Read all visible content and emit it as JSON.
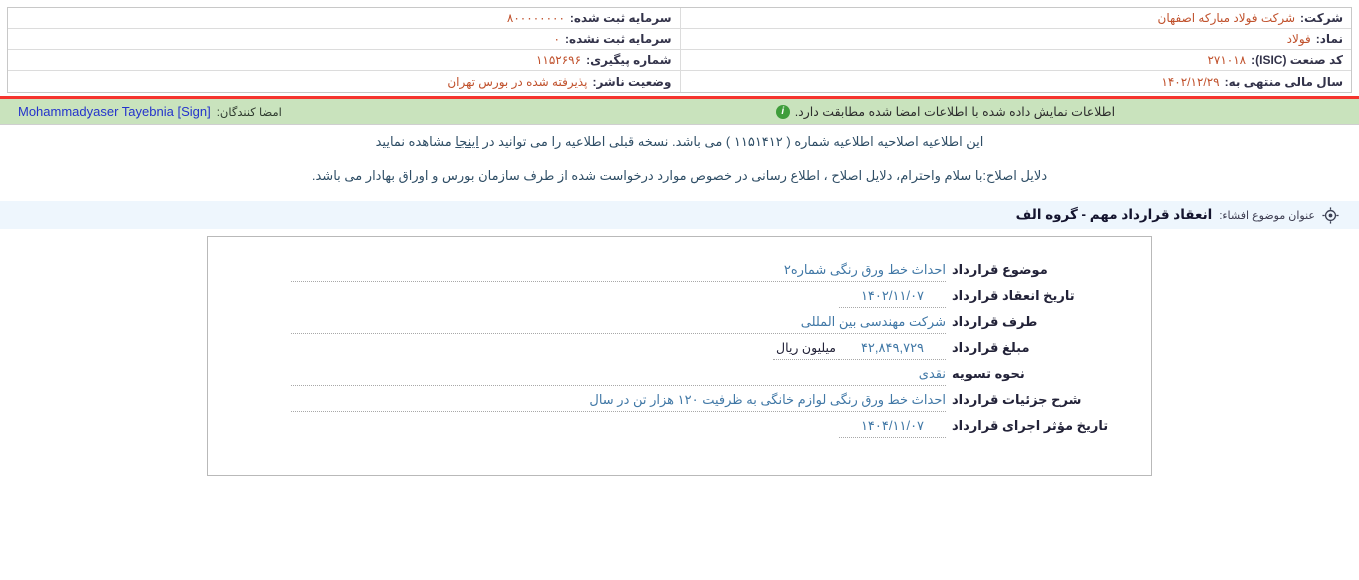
{
  "info_table": {
    "right_rows": [
      {
        "label": "شرکت:",
        "value": "شرکت فولاد مبارکه اصفهان"
      },
      {
        "label": "نماد:",
        "value": "فولاد"
      },
      {
        "label": "کد صنعت (ISIC):",
        "value": "۲۷۱۰۱۸"
      },
      {
        "label": "سال مالی منتهی به:",
        "value": "۱۴۰۲/۱۲/۲۹"
      }
    ],
    "left_rows": [
      {
        "label": "سرمایه ثبت شده:",
        "value": "۸۰۰۰۰۰۰۰۰"
      },
      {
        "label": "سرمایه ثبت نشده:",
        "value": "۰"
      },
      {
        "label": "شماره پیگیری:",
        "value": "۱۱۵۲۶۹۶"
      },
      {
        "label": "وضعیت ناشر:",
        "value": "پذیرفته شده در بورس تهران"
      }
    ]
  },
  "signature_banner": {
    "signers_label": "امضا کنندگان:",
    "signer": "Mohammadyaser Tayebnia [Sign]",
    "info_icon_glyph": "i",
    "match_text": "اطلاعات نمایش داده شده با اطلاعات امضا شده مطابقت دارد."
  },
  "amendment": {
    "notice_before_link": "این اطلاعیه اصلاحیه اطلاعیه شماره ( ۱۱۵۱۴۱۲ ) می باشد. نسخه قبلی اطلاعیه را می توانید در",
    "link_text": "اینجا",
    "notice_after_link": "مشاهده نمایید",
    "reason": "دلایل اصلاح:با سلام واحترام، دلایل اصلاح ، اطلاع رسانی در خصوص موارد درخواست شده از طرف سازمان بورس و اوراق بهادار می باشد."
  },
  "disclosure_header": {
    "label": "عنوان موضوع افشاء:",
    "title": "انعقاد قرارداد مهم - گروه الف"
  },
  "contract_fields": [
    {
      "label": "موضوع قرارداد",
      "value": "احداث خط ورق رنگی شماره۲",
      "wide": true
    },
    {
      "label": "تاریخ انعقاد قرارداد",
      "value": "۱۴۰۲/۱۱/۰۷",
      "wide": false
    },
    {
      "label": "طرف قرارداد",
      "value": "شرکت مهندسی بین المللی",
      "wide": true
    },
    {
      "label": "مبلغ قرارداد",
      "value": "۴۲,۸۴۹,۷۲۹",
      "unit": "میلیون ریال",
      "wide": false
    },
    {
      "label": "نحوه تسویه",
      "value": "نقدی",
      "wide": true
    },
    {
      "label": "شرح جزئیات قرارداد",
      "value": "احداث خط ورق رنگی لوازم خانگی به ظرفیت ۱۲۰ هزار تن در سال",
      "wide": true
    },
    {
      "label": "تاریخ مؤثر اجرای قرارداد",
      "value": "۱۴۰۴/۱۱/۰۷",
      "wide": false
    }
  ],
  "colors": {
    "banner_top_line": "#f5342e",
    "banner_bg": "#c9e3bd",
    "info_value_text": "#c0512c",
    "field_value_text": "#4178a6",
    "signer_link": "#2433cc",
    "disclosure_bar_bg": "#eef6fd",
    "info_icon_green": "#3f9d3b"
  }
}
